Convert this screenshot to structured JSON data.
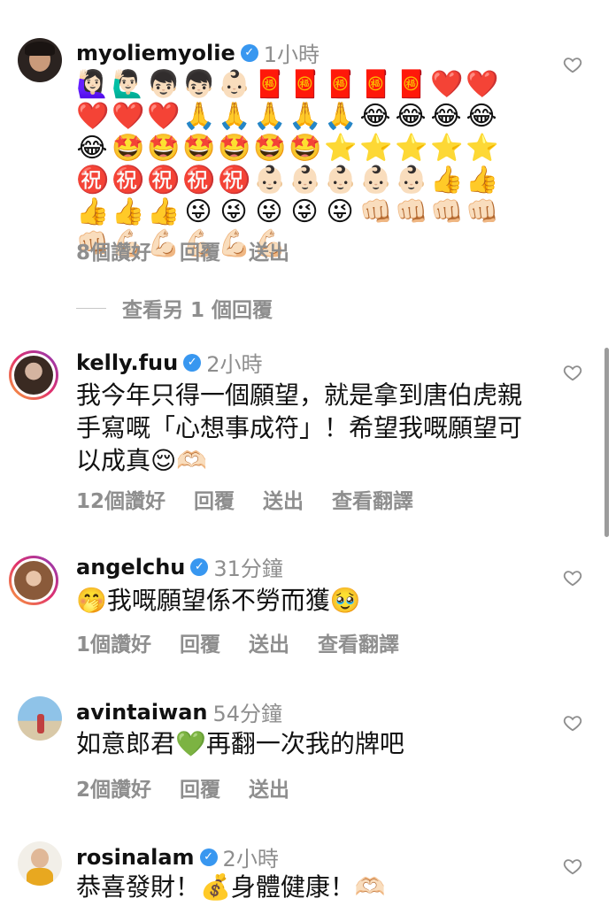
{
  "comments": [
    {
      "username": "myoliemyolie",
      "verified": true,
      "time": "1小時",
      "emoji_text": "🙋🏻‍♀️🙋🏻‍♂️👦🏻👦🏻👶🏻🧧🧧🧧🧧🧧❤️❤️❤️❤️❤️🙏🙏🙏🙏🙏😂😂😂😂😂🤩🤩🤩🤩🤩🤩⭐⭐⭐⭐⭐㊗️㊗️㊗️㊗️㊗️👶🏻👶🏻👶🏻👶🏻👶🏻👍👍👍👍👍😜😜😜😜😜👊🏻👊🏻👊🏻👊🏻👊🏻💪🏻💪🏻💪🏻💪🏻💪🏻",
      "likes": "8個讚好",
      "reply": "回覆",
      "send": "送出"
    },
    {
      "username": "kelly.fuu",
      "verified": true,
      "time": "2小時",
      "text": "我今年只得一個願望，就是拿到唐伯虎親手寫嘅「心想事成符」！希望我嘅願望可以成真😌🫶🏻",
      "likes": "12個讚好",
      "reply": "回覆",
      "send": "送出",
      "translate": "查看翻譯"
    },
    {
      "username": "angelchu",
      "verified": true,
      "time": "31分鐘",
      "text": "🤭我嘅願望係不勞而獲🥹",
      "likes": "1個讚好",
      "reply": "回覆",
      "send": "送出",
      "translate": "查看翻譯"
    },
    {
      "username": "avintaiwan",
      "verified": false,
      "time": "54分鐘",
      "text": "如意郎君💚再翻一次我的牌吧",
      "likes": "2個讚好",
      "reply": "回覆",
      "send": "送出"
    },
    {
      "username": "rosinalam",
      "verified": true,
      "time": "2小時",
      "text": "恭喜發財！💰身體健康！🫶🏻"
    }
  ],
  "view_more_replies": "查看另 1 個回覆",
  "icons": {
    "verified": "verified-badge-icon",
    "like": "heart-outline-icon"
  },
  "colors": {
    "verified": "#3897f0",
    "muted_text": "#8e8e8e"
  }
}
